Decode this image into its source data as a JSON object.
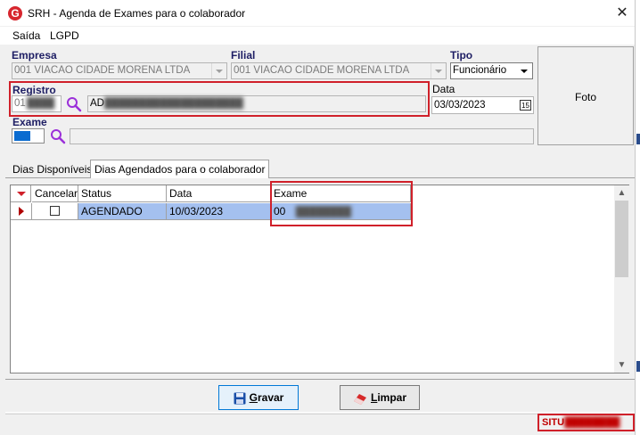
{
  "window": {
    "title": "SRH - Agenda de Exames para o colaborador",
    "app_icon_letter": "G"
  },
  "menu": [
    "Saída",
    "LGPD"
  ],
  "form": {
    "empresa": {
      "label": "Empresa",
      "value": "001 VIACAO CIDADE MORENA LTDA"
    },
    "filial": {
      "label": "Filial",
      "value": "001 VIACAO CIDADE MORENA LTDA"
    },
    "tipo": {
      "label": "Tipo",
      "value": "Funcionário"
    },
    "registro": {
      "label": "Registro",
      "code": "01",
      "name": "AD"
    },
    "data": {
      "label": "Data",
      "value": "03/03/2023",
      "calendar_icon_text": "15"
    },
    "exame": {
      "label": "Exame",
      "value": ""
    },
    "foto_label": "Foto"
  },
  "tabs": [
    {
      "label": "Dias Disponíveis",
      "active": false
    },
    {
      "label": "Dias Agendados para o colaborador",
      "active": true
    }
  ],
  "grid": {
    "columns": [
      "Cancelar",
      "Status",
      "Data",
      "Exame"
    ],
    "rows": [
      {
        "cancelar": false,
        "status": "AGENDADO",
        "data": "10/03/2023",
        "exame": "00"
      }
    ]
  },
  "buttons": {
    "gravar": {
      "first": "G",
      "rest": "ravar"
    },
    "limpar": {
      "first": "L",
      "rest": "impar"
    }
  },
  "status": {
    "text": "SITU"
  },
  "colors": {
    "highlight": "#d0202a",
    "selection": "#a4c0ef",
    "label": "#1e1e64",
    "search_icon": "#9b30d9"
  }
}
